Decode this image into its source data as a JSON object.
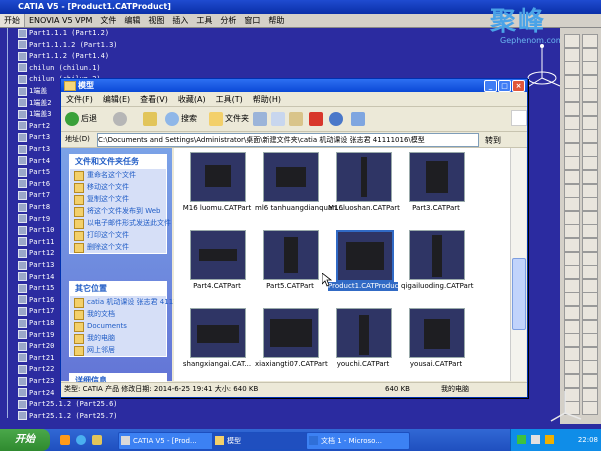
{
  "catia": {
    "title": "CATIA V5 - [Product1.CATProduct]",
    "menu": [
      "开始",
      "ENOVIA V5 VPM",
      "文件",
      "编辑",
      "视图",
      "插入",
      "工具",
      "分析",
      "窗口",
      "帮助"
    ],
    "tree": [
      "Part1.1.1 (Part1.2)",
      "Part1.1.1.2 (Part1.3)",
      "Part1.1.2 (Part1.4)",
      "chilun (chilun.1)",
      "chilun (chilun.2)",
      "1端盖",
      "1端盖2",
      "1端盖3",
      "Part2",
      "Part3",
      "Part3",
      "Part4",
      "Part5",
      "Part6",
      "Part7",
      "Part8",
      "Part9",
      "Part10",
      "Part11",
      "Part12",
      "Part13",
      "Part14",
      "Part15",
      "Part16",
      "Part17",
      "Part18",
      "Part19",
      "Part20",
      "Part21",
      "Part22",
      "Part23",
      "Part24",
      "Part25.1.2 (Part25.6)",
      "Part25.1.2 (Part25.7)"
    ]
  },
  "logo": {
    "main": "聚峰",
    "sub": "Gephenom.com"
  },
  "explorer": {
    "title": "模型",
    "menu": [
      "文件(F)",
      "编辑(E)",
      "查看(V)",
      "收藏(A)",
      "工具(T)",
      "帮助(H)"
    ],
    "toolbar": {
      "back": "后退",
      "search": "搜索",
      "folders": "文件夹"
    },
    "address_label": "地址(D)",
    "address": "C:\\Documents and Settings\\Administrator\\桌面\\新建文件夹\\catia 机动课设  张志君 41111016\\模型",
    "go": "转到",
    "tasks_title": "文件和文件夹任务",
    "tasks": [
      "重命名这个文件",
      "移动这个文件",
      "复制这个文件",
      "将这个文件发布到 Web",
      "以电子邮件形式发送此文件",
      "打印这个文件",
      "删除这个文件"
    ],
    "places_title": "其它位置",
    "places": [
      "catia 机动课设  张志君 41111016",
      "我的文档",
      "Documents",
      "我的电脑",
      "网上邻居"
    ],
    "details_title": "详细信息",
    "files": [
      {
        "name": "M16 luomu.CATPart"
      },
      {
        "name": "ml6 tanhuangdianquan..."
      },
      {
        "name": "M16luoshan.CATPart"
      },
      {
        "name": "Part3.CATPart"
      },
      {
        "name": "Part4.CATPart"
      },
      {
        "name": "Part5.CATPart"
      },
      {
        "name": "Product1.CATProduct",
        "selected": true
      },
      {
        "name": "qigailuoding.CATPart"
      },
      {
        "name": "shangxiangai.CAT..."
      },
      {
        "name": "xiaxiangti07.CATPart"
      },
      {
        "name": "youchi.CATPart"
      },
      {
        "name": "yousai.CATPart"
      }
    ],
    "status": {
      "info": "类型: CATIA 产品 修改日期: 2014-6-25 19:41 大小: 640 KB",
      "size": "640 KB",
      "location": "我的电脑"
    }
  },
  "taskbar": {
    "start": "开始",
    "tasks": [
      "CATIA V5 - [Prod...",
      "模型",
      "文档 1 - Microso..."
    ],
    "clock": "22:08"
  }
}
